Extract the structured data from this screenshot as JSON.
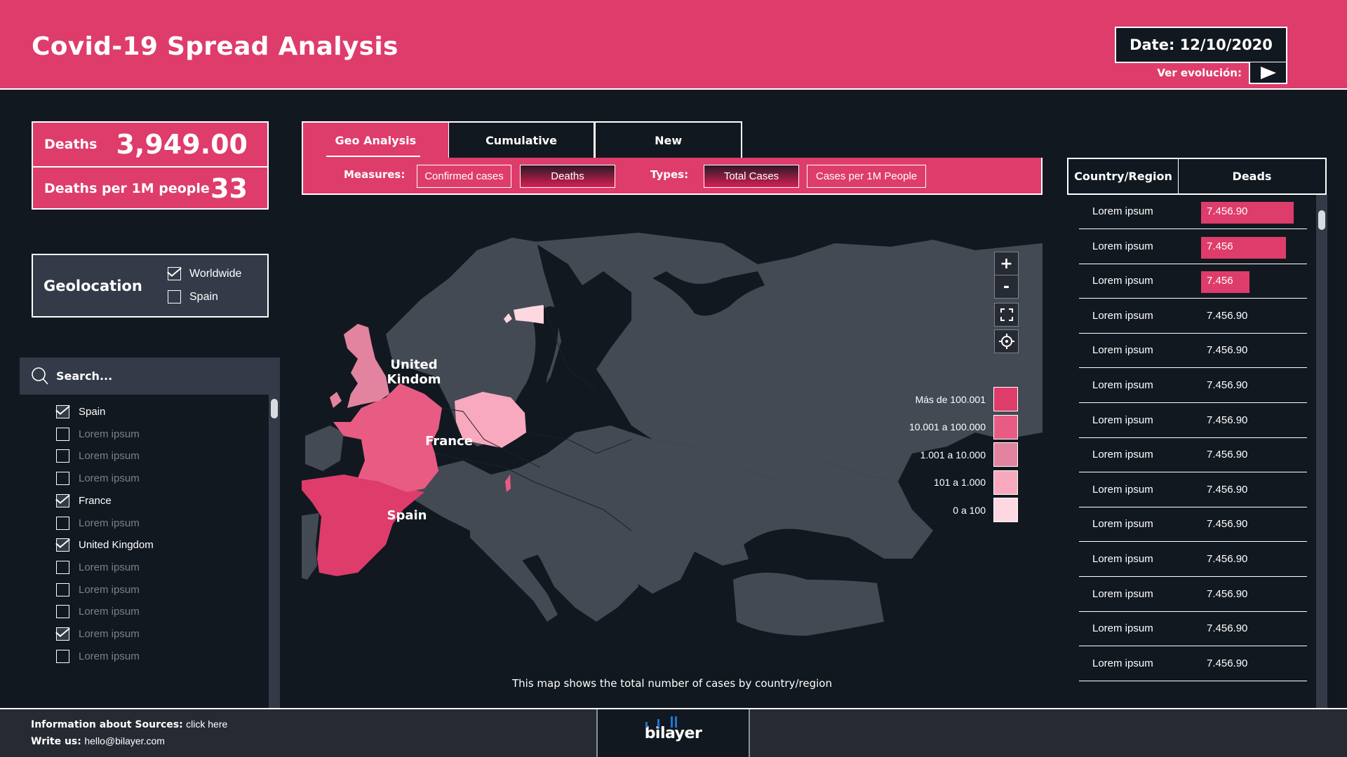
{
  "header": {
    "title": "Covid-19 Spread Analysis",
    "date_label": "Date: 12/10/2020",
    "evolution_label": "Ver evolución:",
    "play_icon": "play-icon"
  },
  "kpis": [
    {
      "label": "Deaths",
      "value": "3,949.00"
    },
    {
      "label": "Deaths per 1M people",
      "value": "33"
    }
  ],
  "geolocation": {
    "title": "Geolocation",
    "options": [
      {
        "label": "Worldwide",
        "checked": true
      },
      {
        "label": "Spain",
        "checked": false
      }
    ]
  },
  "search": {
    "placeholder": "Search...",
    "icon": "search-icon"
  },
  "country_list": [
    {
      "label": "Spain",
      "checked": true
    },
    {
      "label": "Lorem ipsum",
      "checked": false
    },
    {
      "label": "Lorem ipsum",
      "checked": false
    },
    {
      "label": "Lorem ipsum",
      "checked": false
    },
    {
      "label": "France",
      "checked": true
    },
    {
      "label": "Lorem ipsum",
      "checked": false
    },
    {
      "label": "United Kingdom",
      "checked": true
    },
    {
      "label": "Lorem ipsum",
      "checked": false
    },
    {
      "label": "Lorem ipsum",
      "checked": false
    },
    {
      "label": "Lorem ipsum",
      "checked": false
    },
    {
      "label": "Lorem ipsum",
      "checked": true
    },
    {
      "label": "Lorem ipsum",
      "checked": false
    }
  ],
  "tabs": [
    {
      "label": "Geo Analysis",
      "active": true
    },
    {
      "label": "Cumulative",
      "active": false
    },
    {
      "label": "New",
      "active": false
    }
  ],
  "filters": {
    "measures_label": "Measures:",
    "measures": [
      {
        "label": "Confirmed cases",
        "selected": false
      },
      {
        "label": "Deaths",
        "selected": true
      }
    ],
    "types_label": "Types:",
    "types": [
      {
        "label": "Total Cases",
        "selected": true
      },
      {
        "label": "Cases per 1M People",
        "selected": false
      }
    ]
  },
  "map": {
    "controls": {
      "zoom_in": "+",
      "zoom_out": "-",
      "fullscreen_icon": "fullscreen-icon",
      "locate_icon": "locate-icon"
    },
    "legend": [
      {
        "label": "Más de 100.001",
        "color": "#de3c6b"
      },
      {
        "label": "10.001 a 100.000",
        "color": "#e85c84"
      },
      {
        "label": "1.001 a 10.000",
        "color": "#e2849f"
      },
      {
        "label": "101 a 1.000",
        "color": "#f8a9bd"
      },
      {
        "label": "0 a 100",
        "color": "#fdd8e0"
      }
    ],
    "labels": {
      "uk": "United Kindom",
      "france": "France",
      "spain": "Spain"
    },
    "highlighted": [
      {
        "country": "Spain",
        "bucket": "Más de 100.001"
      },
      {
        "country": "France",
        "bucket": "10.001 a 100.000"
      },
      {
        "country": "United Kingdom",
        "bucket": "1.001 a 10.000"
      },
      {
        "country": "Poland",
        "bucket": "101 a 1.000"
      },
      {
        "country": "Estonia",
        "bucket": "0 a 100"
      }
    ],
    "caption": "This map shows the total number of cases by country/region"
  },
  "table": {
    "headers": [
      "Country/Region",
      "Deads"
    ],
    "rows": [
      {
        "country": "Lorem ipsum",
        "value": "7.456.90",
        "bar_fraction": 1.0
      },
      {
        "country": "Lorem ipsum",
        "value": "7.456",
        "bar_fraction": 0.92
      },
      {
        "country": "Lorem ipsum",
        "value": "7.456",
        "bar_fraction": 0.52
      },
      {
        "country": "Lorem ipsum",
        "value": "7.456.90",
        "bar_fraction": 0
      },
      {
        "country": "Lorem ipsum",
        "value": "7.456.90",
        "bar_fraction": 0
      },
      {
        "country": "Lorem ipsum",
        "value": "7.456.90",
        "bar_fraction": 0
      },
      {
        "country": "Lorem ipsum",
        "value": "7.456.90",
        "bar_fraction": 0
      },
      {
        "country": "Lorem ipsum",
        "value": "7.456.90",
        "bar_fraction": 0
      },
      {
        "country": "Lorem ipsum",
        "value": "7.456.90",
        "bar_fraction": 0
      },
      {
        "country": "Lorem ipsum",
        "value": "7.456.90",
        "bar_fraction": 0
      },
      {
        "country": "Lorem ipsum",
        "value": "7.456.90",
        "bar_fraction": 0
      },
      {
        "country": "Lorem ipsum",
        "value": "7.456.90",
        "bar_fraction": 0
      },
      {
        "country": "Lorem ipsum",
        "value": "7.456.90",
        "bar_fraction": 0
      },
      {
        "country": "Lorem ipsum",
        "value": "7.456.90",
        "bar_fraction": 0
      }
    ]
  },
  "footer": {
    "sources_label": "Information about Sources:",
    "sources_link": "click here",
    "write_label": "Write us:",
    "email": "hello@bilayer.com",
    "logo": "bilayer"
  },
  "colors": {
    "accent": "#de3c6b",
    "background": "#121820",
    "panel": "#343a47",
    "footer": "#262a33",
    "land": "#434a54",
    "sea": "#121820"
  }
}
